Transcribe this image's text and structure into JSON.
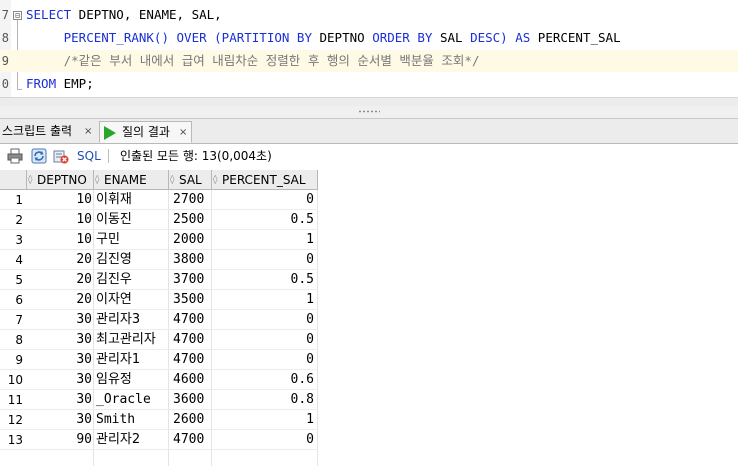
{
  "editor": {
    "lines": [
      {
        "num": "7",
        "fold": "⊟",
        "segments": [
          {
            "text": "SELECT",
            "cls": "kw"
          },
          {
            "text": " DEPTNO, ENAME, SAL,",
            "cls": ""
          }
        ]
      },
      {
        "num": "8",
        "segments": [
          {
            "text": "     PERCENT_RANK() OVER (PARTITION BY",
            "cls": "kw"
          },
          {
            "text": " DEPTNO ",
            "cls": ""
          },
          {
            "text": "ORDER BY",
            "cls": "kw"
          },
          {
            "text": " SAL ",
            "cls": ""
          },
          {
            "text": "DESC) AS",
            "cls": "kw"
          },
          {
            "text": " PERCENT_SAL",
            "cls": ""
          }
        ]
      },
      {
        "num": "9",
        "highlight": true,
        "segments": [
          {
            "text": "     /*같은 부서 내에서 급여 내림차순 정렬한 후 행의 순서별 백분율 조회*/",
            "cls": "cm"
          }
        ]
      },
      {
        "num": "0",
        "segments": [
          {
            "text": "FROM",
            "cls": "kw"
          },
          {
            "text": " EMP;",
            "cls": ""
          }
        ]
      }
    ]
  },
  "tabs": {
    "script_output": {
      "label": "스크립트 출력",
      "close": "×"
    },
    "query_result": {
      "label": "질의 결과",
      "close": "×"
    }
  },
  "toolbar": {
    "sql_label": "SQL",
    "status": "인출된 모든 행: 13(0,004초)"
  },
  "grid": {
    "columns": [
      "DEPTNO",
      "ENAME",
      "SAL",
      "PERCENT_SAL"
    ],
    "rows": [
      [
        "1",
        "10",
        "이휘재",
        "2700",
        "0"
      ],
      [
        "2",
        "10",
        "이동진",
        "2500",
        "0.5"
      ],
      [
        "3",
        "10",
        "구민",
        "2000",
        "1"
      ],
      [
        "4",
        "20",
        "김진영",
        "3800",
        "0"
      ],
      [
        "5",
        "20",
        "김진우",
        "3700",
        "0.5"
      ],
      [
        "6",
        "20",
        "이자연",
        "3500",
        "1"
      ],
      [
        "7",
        "30",
        "관리자3",
        "4700",
        "0"
      ],
      [
        "8",
        "30",
        "최고관리자",
        "4700",
        "0"
      ],
      [
        "9",
        "30",
        "관리자1",
        "4700",
        "0"
      ],
      [
        "10",
        "30",
        "임유정",
        "4600",
        "0.6"
      ],
      [
        "11",
        "30",
        "_Oracle",
        "3600",
        "0.8"
      ],
      [
        "12",
        "30",
        "Smith",
        "2600",
        "1"
      ],
      [
        "13",
        "90",
        "관리자2",
        "4700",
        "0"
      ]
    ]
  }
}
